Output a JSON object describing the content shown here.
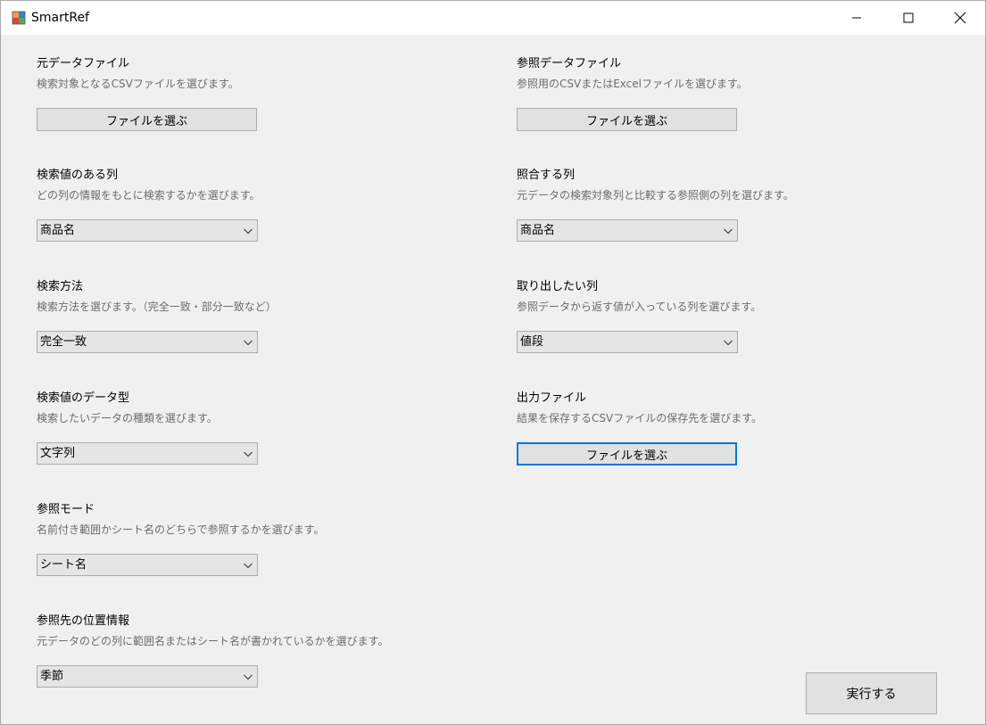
{
  "window": {
    "title": "SmartRef"
  },
  "left": {
    "source_file": {
      "label": "元データファイル",
      "desc": "検索対象となるCSVファイルを選びます。",
      "button": "ファイルを選ぶ"
    },
    "search_column": {
      "label": "検索値のある列",
      "desc": "どの列の情報をもとに検索するかを選びます。",
      "value": "商品名"
    },
    "search_method": {
      "label": "検索方法",
      "desc": "検索方法を選びます。（完全一致・部分一致など）",
      "value": "完全一致"
    },
    "data_type": {
      "label": "検索値のデータ型",
      "desc": "検索したいデータの種類を選びます。",
      "value": "文字列"
    },
    "ref_mode": {
      "label": "参照モード",
      "desc": "名前付き範囲かシート名のどちらで参照するかを選びます。",
      "value": "シート名"
    },
    "ref_location": {
      "label": "参照先の位置情報",
      "desc": "元データのどの列に範囲名またはシート名が書かれているかを選びます。",
      "value": "季節"
    }
  },
  "right": {
    "ref_file": {
      "label": "参照データファイル",
      "desc": "参照用のCSVまたはExcelファイルを選びます。",
      "button": "ファイルを選ぶ"
    },
    "match_column": {
      "label": "照合する列",
      "desc": "元データの検索対象列と比較する参照側の列を選びます。",
      "value": "商品名"
    },
    "extract_column": {
      "label": "取り出したい列",
      "desc": "参照データから返す値が入っている列を選びます。",
      "value": "値段"
    },
    "output_file": {
      "label": "出力ファイル",
      "desc": "結果を保存するCSVファイルの保存先を選びます。",
      "button": "ファイルを選ぶ"
    }
  },
  "actions": {
    "execute": "実行する"
  },
  "colors": {
    "background": "#f0f0f0",
    "focus_border": "#0078d7",
    "desc_text": "#6d6d6d"
  }
}
